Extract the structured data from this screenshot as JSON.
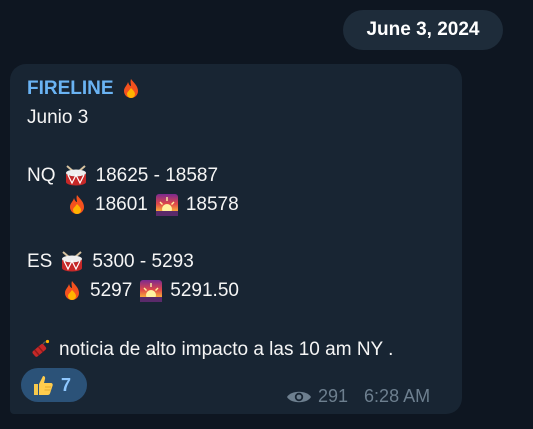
{
  "date_pill": "June 3, 2024",
  "message": {
    "sender": "FIRELINE",
    "line_date": "Junio 3",
    "nq_label": "NQ",
    "nq_range": "18625 - 18587",
    "nq_fire_value": "18601",
    "nq_sunset_value": "18578",
    "es_label": "ES",
    "es_range": "5300 - 5293",
    "es_fire_value": "5297",
    "es_sunset_value": "5291.50",
    "notice": "noticia de alto impacto a las 10 am NY ."
  },
  "reaction": {
    "emoji": "thumbs-up-icon",
    "count": "7"
  },
  "meta": {
    "views": "291",
    "time": "6:28 AM"
  },
  "colors": {
    "background": "#0e1621",
    "bubble": "#182533",
    "sender": "#6ab3f3",
    "reaction_bg": "#2b5278",
    "meta": "#6d7f8f"
  }
}
